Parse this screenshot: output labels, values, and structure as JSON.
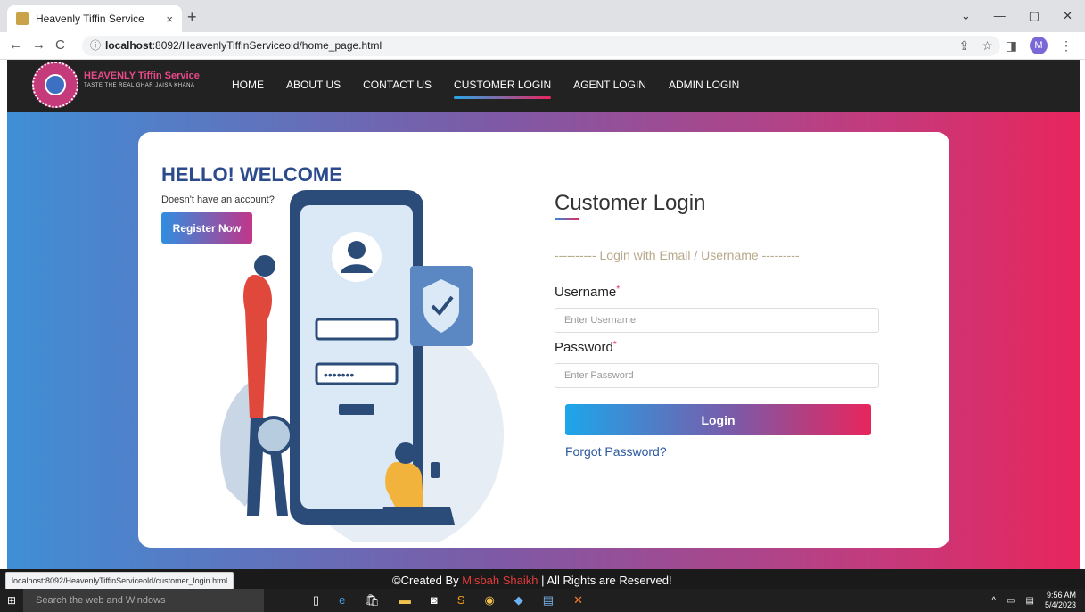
{
  "browser": {
    "tab_title": "Heavenly Tiffin Service",
    "tab_close": "×",
    "new_tab": "+",
    "url_prefix": "localhost",
    "url_rest": ":8092/HeavenlyTiffinServiceold/home_page.html",
    "avatar_initial": "M",
    "status_url": "localhost:8092/HeavenlyTiffinServiceold/customer_login.html"
  },
  "site": {
    "brand": "HEAVENLY Tiffin Service",
    "tagline": "TASTE THE REAL GHAR JAISA KHANA",
    "menu": [
      "HOME",
      "ABOUT US",
      "CONTACT US",
      "CUSTOMER LOGIN",
      "AGENT LOGIN",
      "ADMIN LOGIN"
    ],
    "active_menu": "CUSTOMER LOGIN"
  },
  "welcome": {
    "heading": "HELLO! WELCOME",
    "subtext": "Doesn't have an account?",
    "register_label": "Register Now"
  },
  "login": {
    "title": "Customer Login",
    "divider": "---------- Login with Email / Username ---------",
    "username_label": "Username",
    "username_placeholder": "Enter Username",
    "password_label": "Password",
    "password_placeholder": "Enter Password",
    "required_mark": "*",
    "button_label": "Login",
    "forgot_label": "Forgot Password?"
  },
  "footer": {
    "prefix": "©Created By ",
    "author": "Misbah Shaikh",
    "suffix": " | All Rights are Reserved!"
  },
  "taskbar": {
    "search_placeholder": "Search the web and Windows",
    "time": "9:56 AM",
    "date": "5/4/2023"
  },
  "colors": {
    "gradient_start": "#3f8fd6",
    "gradient_end": "#e8255d",
    "header_bg": "#222222",
    "heading_blue": "#2c4b8c"
  }
}
